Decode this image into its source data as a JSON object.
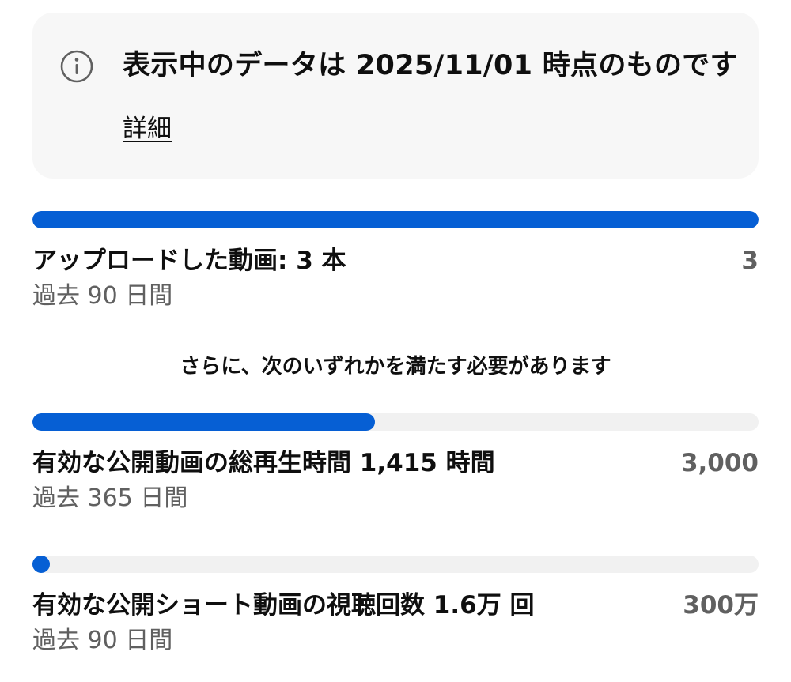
{
  "notice": {
    "icon": "info-icon",
    "message": "表示中のデータは 2025/11/01 時点のものです",
    "details_link": "詳細"
  },
  "colors": {
    "progress_fill": "#065fd4",
    "progress_track": "#f1f1f1",
    "notice_background": "#f7f7f7",
    "secondary_text": "#606060"
  },
  "requirements": {
    "uploads": {
      "title": "アップロードした動画: 3 本",
      "target": "3",
      "period": "過去 90 日間",
      "progress": 1.0
    },
    "additional_condition": "さらに、次のいずれかを満たす必要があります",
    "watch_hours": {
      "title": "有効な公開動画の総再生時間 1,415 時間",
      "target": "3,000",
      "period": "過去 365 日間",
      "progress": 0.4717
    },
    "shorts_views": {
      "title": "有効な公開ショート動画の視聴回数 1.6万 回",
      "target": "300万",
      "period": "過去 90 日間",
      "progress": 0.0053
    }
  }
}
